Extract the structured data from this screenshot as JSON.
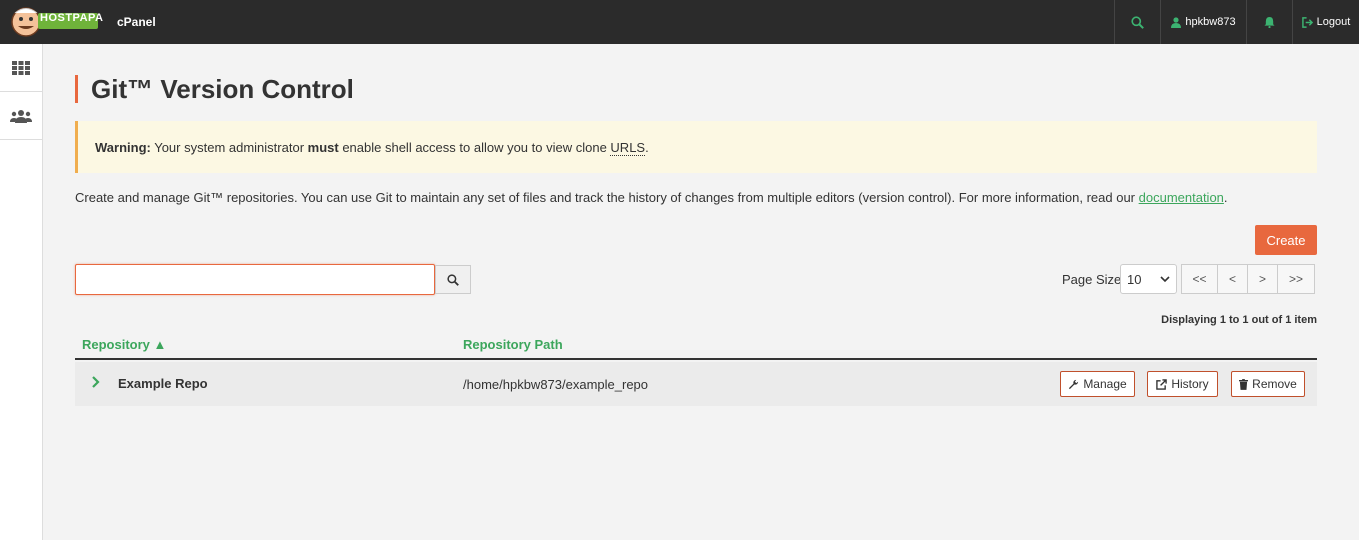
{
  "header": {
    "logo_text": "HOSTPAPA",
    "product": "cPanel",
    "username": "hpkbw873",
    "logout": "Logout",
    "icons": [
      "search-icon",
      "user-icon",
      "bell-icon",
      "logout-icon"
    ]
  },
  "sidebar": {
    "items": [
      {
        "icon": "apps-grid-icon"
      },
      {
        "icon": "users-icon"
      }
    ]
  },
  "page": {
    "title": "Git™ Version Control",
    "warning": {
      "label": "Warning:",
      "text_before": " Your system administrator ",
      "emphasis": "must",
      "text_after": " enable shell access to allow you to view clone ",
      "abbr": "URLS",
      "end": "."
    },
    "description": "Create and manage Git™ repositories. You can use Git to maintain any set of files and track the history of changes from multiple editors (version control). For more information, read our ",
    "doc_link": "documentation",
    "description_end": ".",
    "create_button": "Create",
    "search": {
      "value": "",
      "placeholder": ""
    },
    "page_size_label": "Page Size",
    "page_size_value": "10",
    "pager": {
      "first": "<<",
      "prev": "<",
      "next": ">",
      "last": ">>"
    },
    "displaying": "Displaying 1 to 1 out of 1 item",
    "table": {
      "headers": {
        "repository": "Repository",
        "sort_indicator": "▲",
        "path": "Repository Path"
      },
      "rows": [
        {
          "name": "Example Repo",
          "path": "/home/hpkbw873/example_repo",
          "actions": {
            "manage": "Manage",
            "history": "History",
            "remove": "Remove"
          }
        }
      ]
    }
  },
  "colors": {
    "accent": "#e8683e",
    "link_green": "#3ca65c",
    "topbar": "#2b2b2b",
    "warning_bg": "#fcf8e3"
  }
}
